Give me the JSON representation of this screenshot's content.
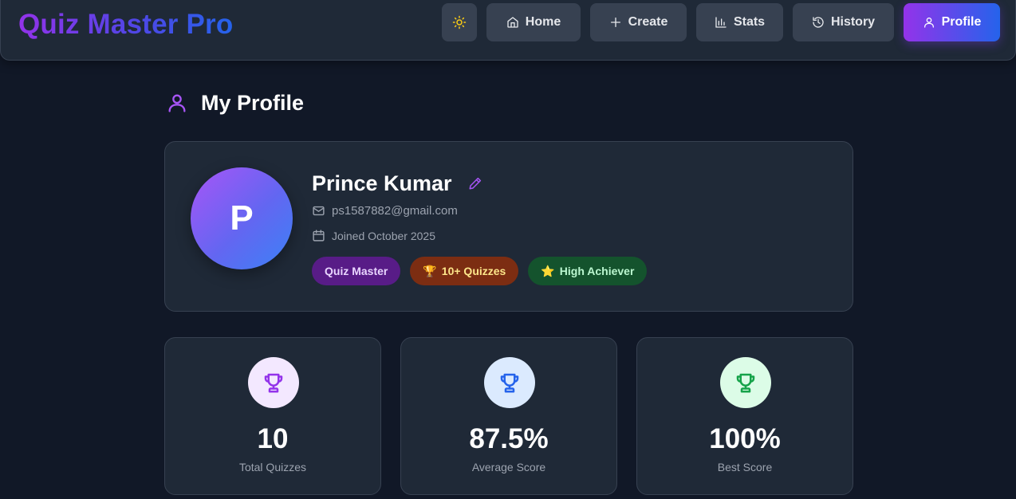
{
  "app": {
    "title": "Quiz Master Pro"
  },
  "nav": {
    "theme_toggle_icon": "sun-icon",
    "items": [
      {
        "label": "Home",
        "icon": "home-icon"
      },
      {
        "label": "Create",
        "icon": "plus-icon"
      },
      {
        "label": "Stats",
        "icon": "bar-chart-icon"
      },
      {
        "label": "History",
        "icon": "history-icon"
      },
      {
        "label": "Profile",
        "icon": "user-icon",
        "active": true
      }
    ]
  },
  "page": {
    "title": "My Profile",
    "title_icon": "user-icon"
  },
  "profile": {
    "initial": "P",
    "name": "Prince Kumar",
    "email": "ps1587882@gmail.com",
    "joined": "Joined October 2025",
    "badges": [
      {
        "label": "Quiz Master",
        "icon": "",
        "color": "#581c87"
      },
      {
        "label": "10+ Quizzes",
        "icon": "trophy-emoji",
        "emoji": "🏆",
        "color": "#7c2d12"
      },
      {
        "label": "High Achiever",
        "icon": "star-emoji",
        "emoji": "⭐",
        "color": "#14532d"
      }
    ]
  },
  "stats": [
    {
      "value": "10",
      "label": "Total Quizzes",
      "icon": "trophy-icon",
      "icon_color": "#9333ea",
      "bg": "#f3e8ff"
    },
    {
      "value": "87.5%",
      "label": "Average Score",
      "icon": "trophy-icon",
      "icon_color": "#2563eb",
      "bg": "#dbeafe"
    },
    {
      "value": "100%",
      "label": "Best Score",
      "icon": "trophy-icon",
      "icon_color": "#16a34a",
      "bg": "#dcfce7"
    }
  ],
  "colors": {
    "background": "#111827",
    "card": "#1f2937",
    "accent_purple": "#9333ea",
    "accent_blue": "#2563eb"
  }
}
